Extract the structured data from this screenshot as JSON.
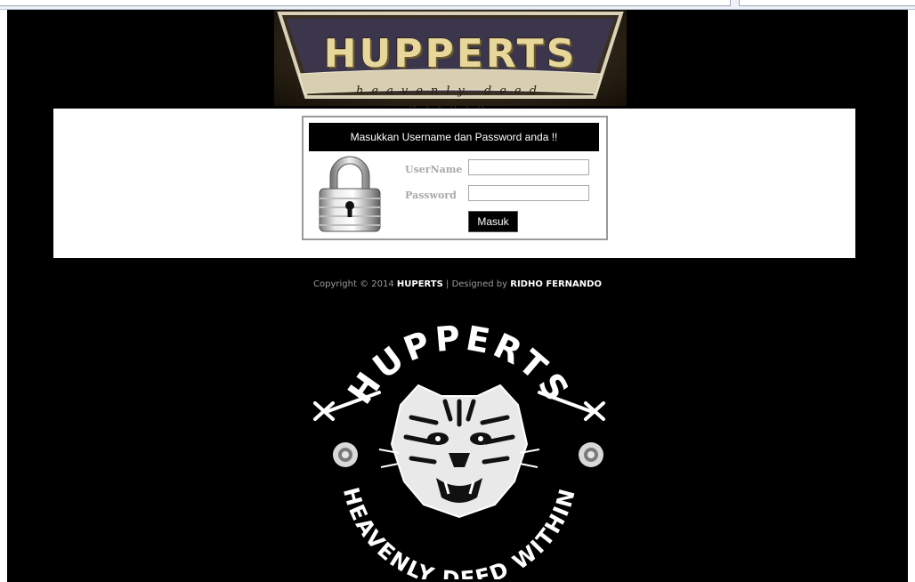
{
  "header": {
    "brand": "HUPPERTS",
    "tagline": "heavenly deed within"
  },
  "login": {
    "prompt": "Masukkan Username dan Password anda !!",
    "username_label": "UserName",
    "password_label": "Password",
    "username_value": "",
    "password_value": "",
    "submit_label": "Masuk"
  },
  "footer": {
    "copyright_prefix": "Copyright © 2014",
    "site_name": "HUPERTS",
    "separator": "|",
    "designed_by": "Designed by",
    "designer": "RIDHO FERNANDO"
  },
  "emblem": {
    "top_text": "HUPPERTS",
    "bottom_text": "HEAVENLY DEED WITHIN"
  },
  "icons": {
    "lock": "padlock-icon",
    "emblem": "tiger-icon"
  },
  "colors": {
    "page_background": "#000000",
    "content_background": "#ffffff",
    "banner_gold": "#e8d79a",
    "label_gray": "#a9a9a9"
  }
}
